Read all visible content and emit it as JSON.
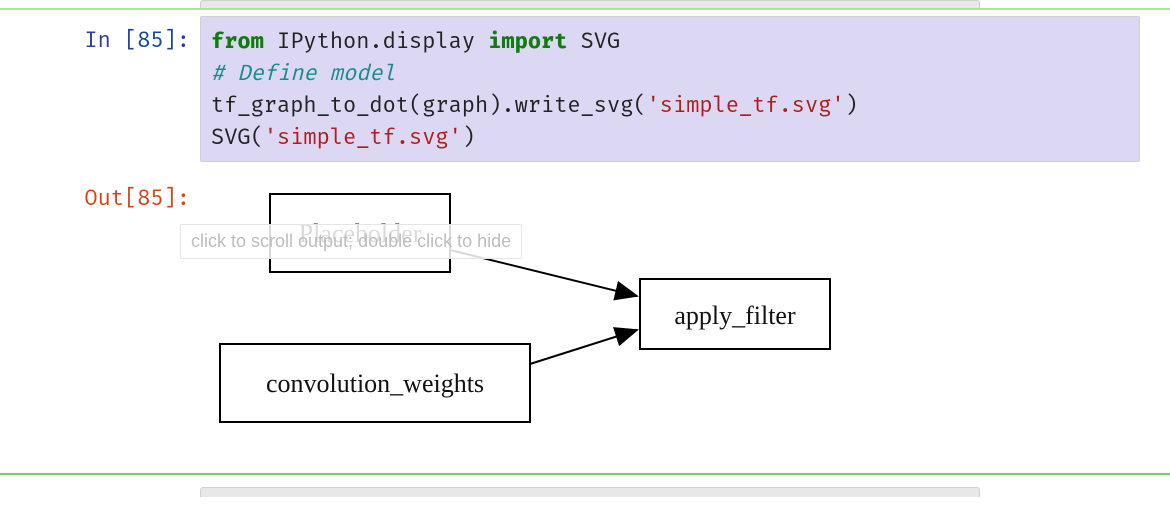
{
  "cell": {
    "in_prompt_prefix": "In ",
    "out_prompt_prefix": "Out",
    "execution_count": "85",
    "code_tokens": {
      "kw_from": "from",
      "mod": " IPython.display ",
      "kw_import": "import",
      "name_svg": " SVG",
      "comment": "# Define model",
      "line3_pre": "tf_graph_to_dot(graph).write_svg(",
      "line3_str": "'simple_tf.svg'",
      "line3_post": ")",
      "line4_pre": "SVG(",
      "line4_str": "'simple_tf.svg'",
      "line4_post": ")"
    },
    "tooltip": "click to scroll output; double click to hide",
    "graph": {
      "node_placeholder": "Placeholder",
      "node_conv_weights": "convolution_weights",
      "node_apply_filter": "apply_filter"
    }
  }
}
